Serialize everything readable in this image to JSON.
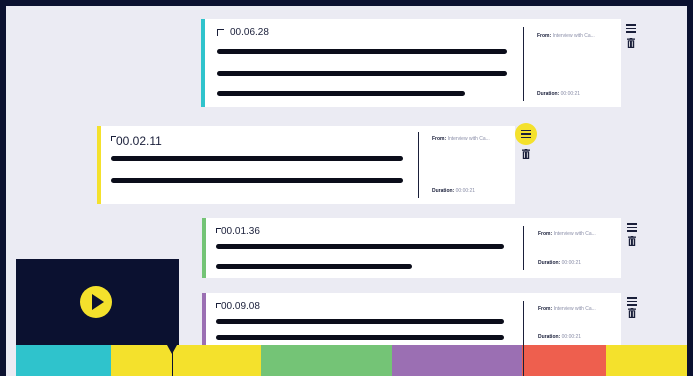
{
  "colors": {
    "background": "#0b1130",
    "workspace": "#ebebf3",
    "accent_yellow": "#f4e12c",
    "cyan": "#2fc3cc",
    "yellow": "#f4e12c",
    "green": "#74c476",
    "purple": "#9b6fb3",
    "coral": "#ee5f4e"
  },
  "clips": [
    {
      "timecode": "00.06.28",
      "from_label": "From:",
      "from_value": "Interview with Ca...",
      "duration_label": "Duration:",
      "duration_value": "00:00:21",
      "color": "cyan"
    },
    {
      "timecode": "00.02.11",
      "from_label": "From:",
      "from_value": "Interview with Ca...",
      "duration_label": "Duration:",
      "duration_value": "00:00:21",
      "color": "yellow"
    },
    {
      "timecode": "00.01.36",
      "from_label": "From:",
      "from_value": "Interview with Ca...",
      "duration_label": "Duration:",
      "duration_value": "00:00:21",
      "color": "green"
    },
    {
      "timecode": "00.09.08",
      "from_label": "From:",
      "from_value": "Interview with Ca...",
      "duration_label": "Duration:",
      "duration_value": "00:00:21",
      "color": "purple"
    }
  ],
  "icons": {
    "menu": "menu-icon",
    "delete": "trash-icon",
    "play": "play-icon"
  },
  "timeline": {
    "segments": [
      "cyan",
      "yellow",
      "green",
      "purple",
      "coral",
      "yellow"
    ]
  }
}
